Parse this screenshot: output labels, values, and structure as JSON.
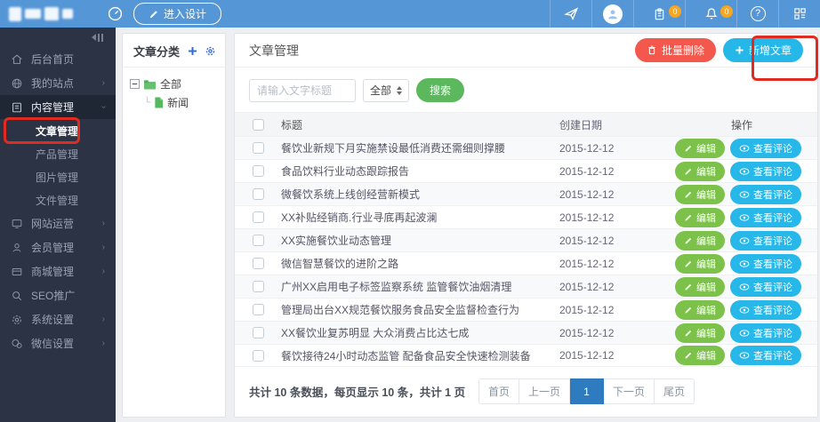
{
  "topbar": {
    "design_button_label": "进入设计",
    "clipboard_badge": "0",
    "bell_badge": "0",
    "help_glyph": "?"
  },
  "sidebar": {
    "items": [
      {
        "label": "后台首页"
      },
      {
        "label": "我的站点"
      },
      {
        "label": "内容管理"
      },
      {
        "label": "文章管理"
      },
      {
        "label": "产品管理"
      },
      {
        "label": "图片管理"
      },
      {
        "label": "文件管理"
      },
      {
        "label": "网站运营"
      },
      {
        "label": "会员管理"
      },
      {
        "label": "商城管理"
      },
      {
        "label": "SEO推广"
      },
      {
        "label": "系统设置"
      },
      {
        "label": "微信设置"
      }
    ]
  },
  "category_panel": {
    "title": "文章分类",
    "tree": {
      "root": "全部",
      "child": "新闻"
    }
  },
  "main": {
    "title": "文章管理",
    "batch_delete_label": "批量删除",
    "add_article_label": "新增文章",
    "search": {
      "placeholder": "请输入文字标题",
      "filter_value": "全部",
      "search_label": "搜索"
    },
    "table": {
      "headers": {
        "title": "标题",
        "date": "创建日期",
        "actions": "操作"
      },
      "edit_label": "编辑",
      "comment_label": "查看评论",
      "rows": [
        {
          "title": "餐饮业新规下月实施禁设最低消费还需细则撑腰",
          "date": "2015-12-12"
        },
        {
          "title": "食品饮料行业动态跟踪报告",
          "date": "2015-12-12"
        },
        {
          "title": "微餐饮系统上线创经营新模式",
          "date": "2015-12-12"
        },
        {
          "title": "XX补贴经销商.行业寻底再起波澜",
          "date": "2015-12-12"
        },
        {
          "title": "XX实施餐饮业动态管理",
          "date": "2015-12-12"
        },
        {
          "title": "微信智慧餐饮的进阶之路",
          "date": "2015-12-12"
        },
        {
          "title": "广州XX启用电子标签监察系统 监管餐饮油烟清理",
          "date": "2015-12-12"
        },
        {
          "title": "管理局出台XX规范餐饮服务食品安全监督检查行为",
          "date": "2015-12-12"
        },
        {
          "title": "XX餐饮业复苏明显 大众消费占比达七成",
          "date": "2015-12-12"
        },
        {
          "title": "餐饮接待24小时动态监管 配备食品安全快速检测装备",
          "date": "2015-12-12"
        }
      ]
    },
    "footer": {
      "summary": "共计 10 条数据，每页显示 10 条，共计 1 页",
      "pagination": [
        "首页",
        "上一页",
        "1",
        "下一页",
        "尾页"
      ]
    }
  },
  "colors": {
    "topbar_blue": "#5596d6",
    "sidebar_dark": "#2b3344",
    "delete_red": "#f4574b",
    "add_blue": "#26b7e9",
    "search_green": "#5cb85c",
    "edit_green": "#7cc24a",
    "comment_blue": "#27b7e9",
    "active_page_blue": "#2e7bbf",
    "badge_orange": "#f5a623",
    "annotation_red": "#e02b20"
  }
}
